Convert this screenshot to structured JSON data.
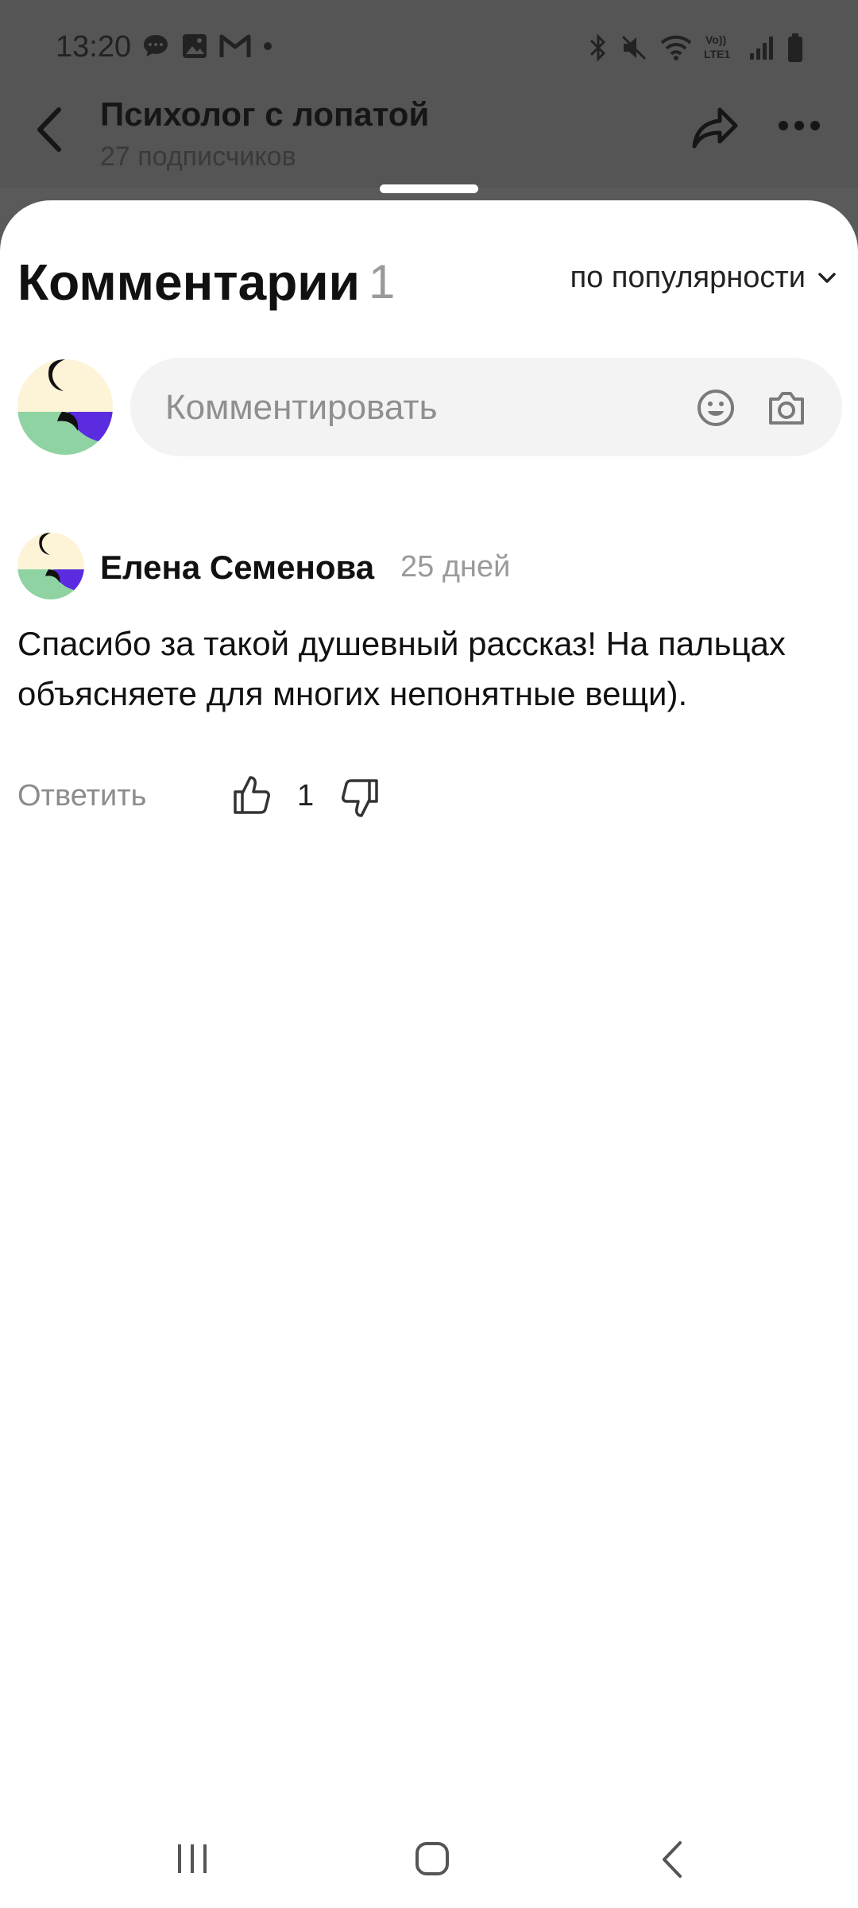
{
  "status_bar": {
    "time": "13:20",
    "left_icons": [
      "chat-bubble-icon",
      "gallery-icon",
      "gmail-icon",
      "dot-icon"
    ],
    "right_icons": [
      "bluetooth-icon",
      "mute-icon",
      "wifi-icon",
      "volte-lte-icon",
      "signal-icon",
      "battery-icon"
    ],
    "lte_label": "Vo))\nLTE1"
  },
  "background_header": {
    "title": "Психолог с лопатой",
    "subtitle": "27 подписчиков"
  },
  "comments_sheet": {
    "title": "Комментарии",
    "count": "1",
    "sort_label": "по популярности",
    "input_placeholder": "Комментировать",
    "comments": [
      {
        "author": "Елена Семенова",
        "time": "25 дней",
        "text": "Спасибо за такой душевный рассказ! На пальцах объясняете для многих непонятные вещи).",
        "reply_label": "Ответить",
        "likes": "1"
      }
    ]
  },
  "colors": {
    "avatar_cream": "#fdf3d6",
    "avatar_green": "#8fd3a3",
    "avatar_purple": "#5b2be0",
    "dim_overlay": "#555555"
  }
}
